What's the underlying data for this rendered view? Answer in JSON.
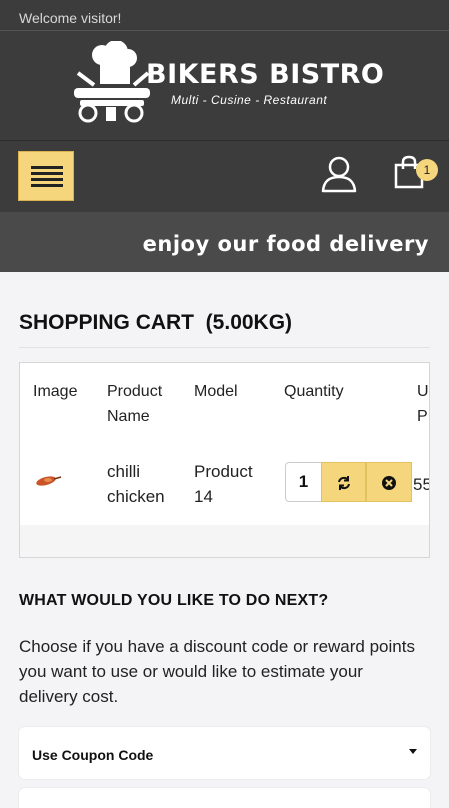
{
  "header": {
    "welcome": "Welcome visitor!",
    "brand": "BIKERS BISTRO",
    "tagline": "Multi - Cusine - Restaurant",
    "cart_count": "1"
  },
  "promo": {
    "text": "enjoy our food delivery"
  },
  "cart": {
    "title": "SHOPPING CART  (5.00KG)",
    "columns": [
      "Image",
      "Product\nName",
      "Model",
      "Quantity",
      "U\nP"
    ],
    "items": [
      {
        "product_name": "chilli\nchicken",
        "model": "Product\n14",
        "quantity": "1",
        "price": "55"
      }
    ]
  },
  "next": {
    "title": "WHAT WOULD YOU LIKE TO DO NEXT?",
    "description": "Choose if you have a discount code or reward points you want to use or would like to estimate your delivery cost.",
    "coupon_label": "Use Coupon Code"
  },
  "icons": {
    "menu": "hamburger-icon",
    "account": "user-icon",
    "cart": "shopping-bag-icon",
    "update": "refresh-icon",
    "remove": "close-circle-icon"
  },
  "colors": {
    "header_bg": "#3c3c3c",
    "accent": "#f5d67c",
    "page_bg": "#f4f4f6"
  }
}
